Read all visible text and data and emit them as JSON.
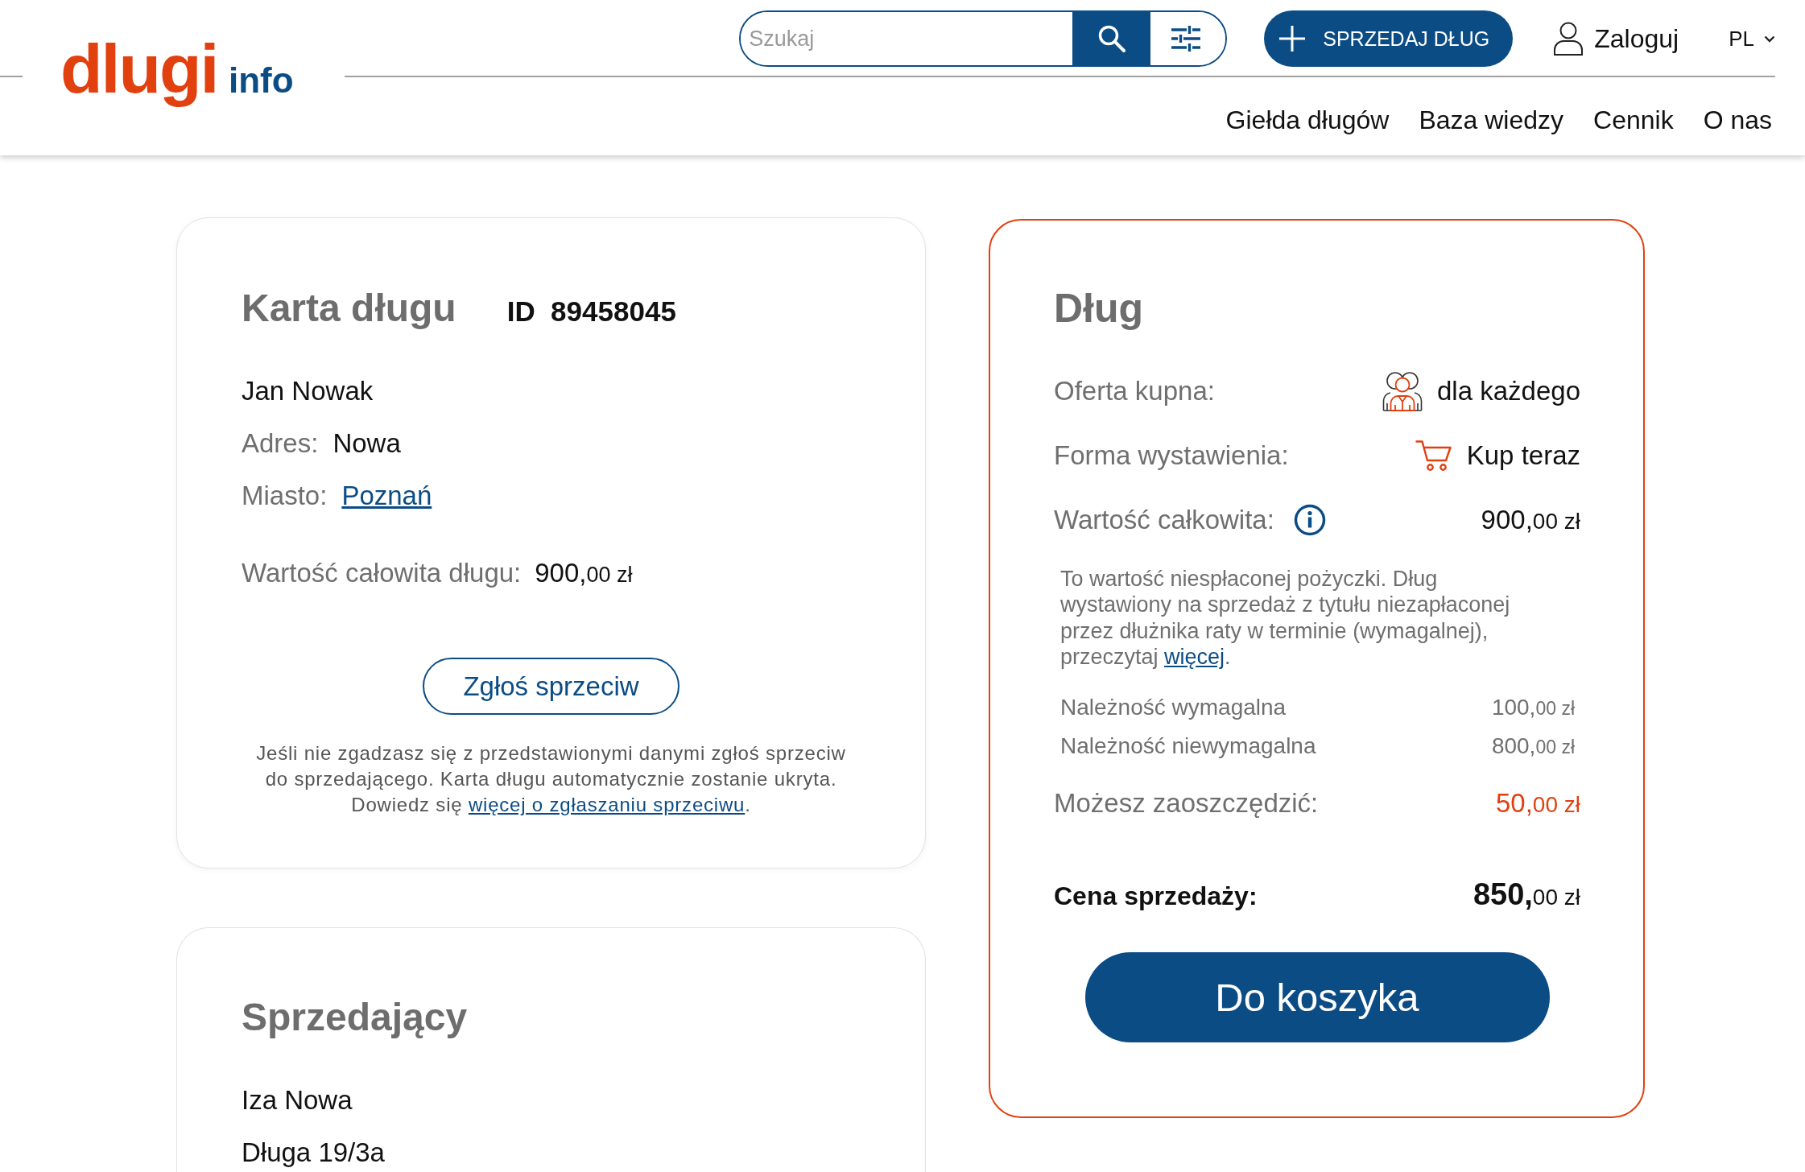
{
  "header": {
    "logo": {
      "primary": "dlugi",
      "secondary": "info"
    },
    "search": {
      "placeholder": "Szukaj"
    },
    "sell_button": "SPRZEDAJ DŁUG",
    "login": "Zaloguj",
    "language": "PL",
    "nav": [
      "Giełda długów",
      "Baza wiedzy",
      "Cennik",
      "O nas"
    ]
  },
  "debt_card": {
    "title": "Karta długu",
    "id_label": "ID",
    "id": "89458045",
    "debtor_name": "Jan Nowak",
    "fields": [
      {
        "kind": "text",
        "label": "Adres:",
        "value": "Nowa"
      },
      {
        "kind": "link",
        "label": "Miasto:",
        "value": "Poznań"
      }
    ],
    "total": {
      "label": "Wartość całowita długu:",
      "whole": "900,",
      "fraction": "00 zł"
    },
    "objection_button": "Zgłoś sprzeciw",
    "note": {
      "text": "Jeśli nie zgadzasz się z przedstawionymi danymi zgłoś sprzeciw do sprzedającego. Karta długu automatycznie zostanie ukryta. Dowiedz się",
      "link": "więcej o zgłaszaniu sprzeciwu",
      "end": "."
    }
  },
  "seller_card": {
    "title": "Sprzedający",
    "name": "Iza Nowa",
    "address": "Długa 19/3a"
  },
  "offer_card": {
    "title": "Dług",
    "rows": [
      {
        "kind": "audience",
        "label": "Oferta kupna:",
        "value": "dla każdego"
      },
      {
        "kind": "cart",
        "label": "Forma wystawienia:",
        "value": "Kup teraz"
      },
      {
        "kind": "info",
        "label": "Wartość całkowita:",
        "whole": "900,",
        "fraction": "00 zł"
      }
    ],
    "description": {
      "text": "To wartość niespłaconej pożyczki. Dług wystawiony na sprzedaż z tytułu niezapłaconej przez dłużnika raty w terminie (wymagalnej), przeczytaj",
      "link": "więcej",
      "end": "."
    },
    "breakdown": [
      {
        "label": "Należność wymagalna",
        "whole": "100,",
        "fraction": "00 zł"
      },
      {
        "label": "Należność niewymagalna",
        "whole": "800,",
        "fraction": "00 zł"
      }
    ],
    "savings": {
      "label": "Możesz zaoszczędzić:",
      "whole": "50,",
      "fraction": "00 zł"
    },
    "price": {
      "label": "Cena sprzedaży:",
      "whole": "850,",
      "fraction": "00 zł"
    },
    "cart_button": "Do koszyka"
  }
}
